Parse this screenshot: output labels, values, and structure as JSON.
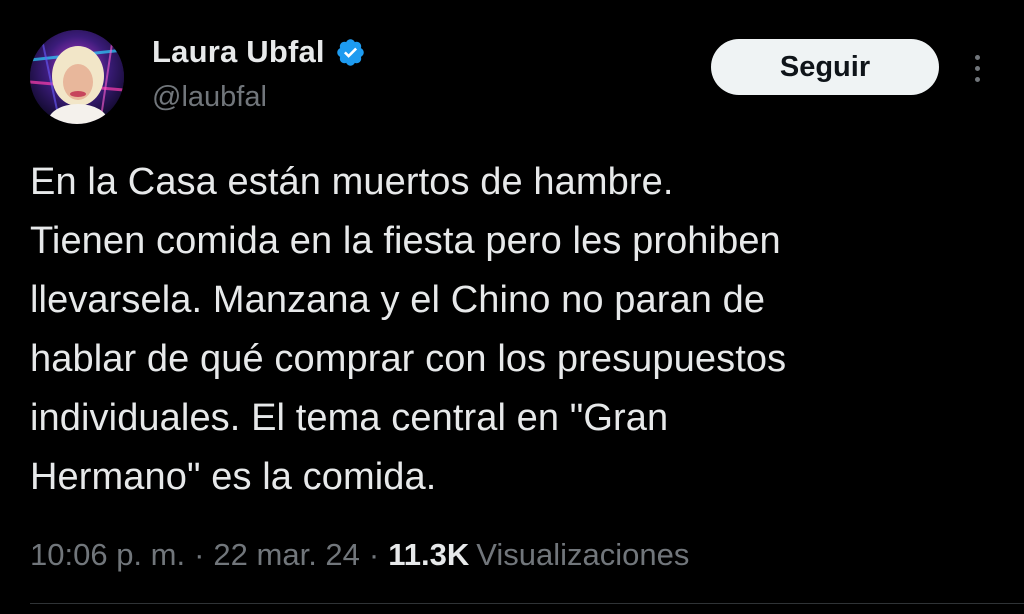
{
  "author": {
    "display_name": "Laura Ubfal",
    "handle": "@laubfal",
    "verified_icon": "verified-badge-icon",
    "verified_color": "#1d9bf0"
  },
  "actions": {
    "follow_label": "Seguir",
    "more_icon": "more-vertical-icon"
  },
  "tweet": {
    "text": "En la Casa están muertos de hambre.\nTienen comida en la fiesta pero les prohiben\nllevarsela. Manzana y el Chino no paran de\nhablar de qué comprar con los presupuestos\nindividuales. El tema central en \"Gran\nHermano\" es la comida."
  },
  "meta": {
    "time": "10:06 p. m.",
    "separator": "·",
    "date": "22 mar. 24",
    "views_count": "11.3K",
    "views_label": "Visualizaciones"
  },
  "colors": {
    "background": "#000000",
    "text": "#e7e9ea",
    "secondary_text": "#71767b",
    "button_bg": "#eff3f4"
  }
}
